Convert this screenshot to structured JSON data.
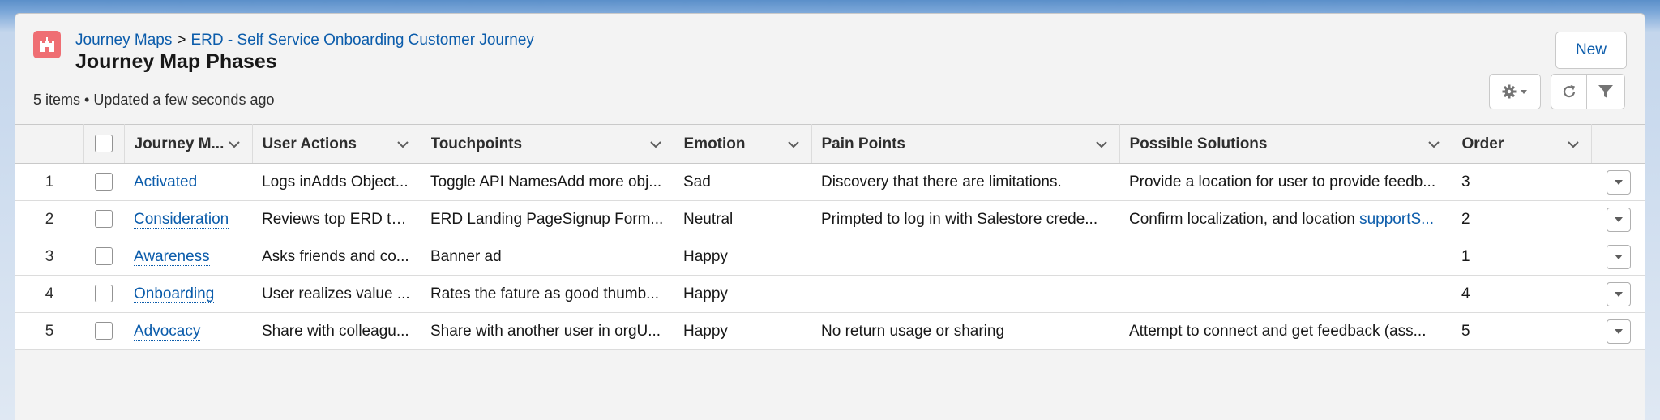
{
  "breadcrumb": {
    "parent": "Journey Maps",
    "separator": ">",
    "current": "ERD - Self Service Onboarding Customer Journey"
  },
  "page_title": "Journey Map Phases",
  "meta": "5 items • Updated a few seconds ago",
  "buttons": {
    "new_label": "New"
  },
  "icons": {
    "object": "castle-icon",
    "settings": "gear-icon",
    "refresh": "refresh-icon",
    "filter": "filter-icon",
    "sort": "chevron-down-icon",
    "row_action": "caret-down-icon"
  },
  "colors": {
    "accent": "#0b5cab",
    "object_icon": "#ef6e73"
  },
  "table": {
    "columns": [
      "Journey M...",
      "User Actions",
      "Touchpoints",
      "Emotion",
      "Pain Points",
      "Possible Solutions",
      "Order"
    ],
    "rows": [
      {
        "num": "1",
        "name": "Activated",
        "user_actions": "Logs inAdds Object...",
        "touchpoints": "Toggle API NamesAdd more obj...",
        "emotion": "Sad",
        "pain_points": "Discovery that there are limitations.",
        "solutions": "Provide a location for user to provide feedb...",
        "solutions_link": "",
        "order": "3"
      },
      {
        "num": "2",
        "name": "Consideration",
        "user_actions": "Reviews top ERD to...",
        "touchpoints": "ERD Landing PageSignup Form...",
        "emotion": "Neutral",
        "pain_points": "Primpted to log in with Salestore crede...",
        "solutions": "Confirm localization, and location ",
        "solutions_link": "supportS...",
        "order": "2"
      },
      {
        "num": "3",
        "name": "Awareness",
        "user_actions": "Asks friends and co...",
        "touchpoints": "Banner ad",
        "emotion": "Happy",
        "pain_points": "",
        "solutions": "",
        "solutions_link": "",
        "order": "1"
      },
      {
        "num": "4",
        "name": "Onboarding",
        "user_actions": "User realizes value ...",
        "touchpoints": "Rates the fature as good thumb...",
        "emotion": "Happy",
        "pain_points": "",
        "solutions": "",
        "solutions_link": "",
        "order": "4"
      },
      {
        "num": "5",
        "name": "Advocacy",
        "user_actions": "Share with colleagu...",
        "touchpoints": "Share with another user in orgU...",
        "emotion": "Happy",
        "pain_points": "No return usage or sharing",
        "solutions": "Attempt to connect and get feedback (ass...",
        "solutions_link": "",
        "order": "5"
      }
    ]
  }
}
